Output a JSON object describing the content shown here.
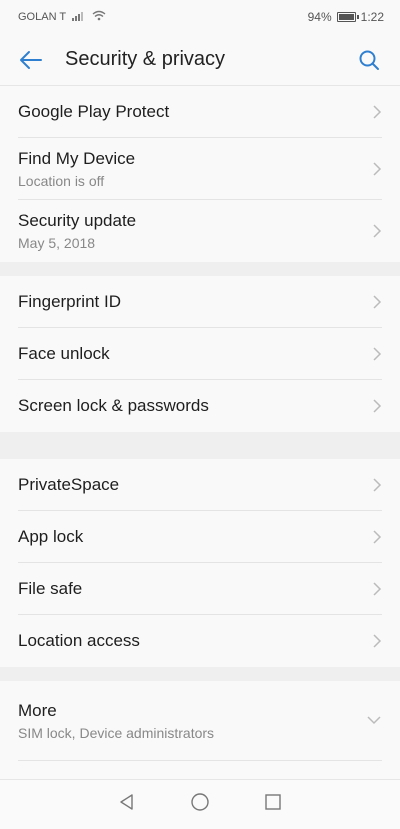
{
  "status_bar": {
    "carrier": "GOLAN T",
    "battery": "94%",
    "time": "1:22"
  },
  "app_bar": {
    "title": "Security & privacy",
    "back_icon": "arrow-left-icon",
    "search_icon": "search-icon"
  },
  "sections": [
    {
      "items": [
        {
          "title": "Google Play Protect",
          "subtitle": ""
        },
        {
          "title": "Find My Device",
          "subtitle": "Location is off"
        },
        {
          "title": "Security update",
          "subtitle": "May 5, 2018"
        }
      ]
    },
    {
      "items": [
        {
          "title": "Fingerprint ID",
          "subtitle": ""
        },
        {
          "title": "Face unlock",
          "subtitle": ""
        },
        {
          "title": "Screen lock & passwords",
          "subtitle": ""
        }
      ]
    },
    {
      "items": [
        {
          "title": "PrivateSpace",
          "subtitle": ""
        },
        {
          "title": "App lock",
          "subtitle": ""
        },
        {
          "title": "File safe",
          "subtitle": ""
        },
        {
          "title": "Location access",
          "subtitle": ""
        }
      ]
    }
  ],
  "more": {
    "title": "More",
    "subtitle": "SIM lock, Device administrators"
  },
  "colors": {
    "accent": "#2f7fd1",
    "divider": "#e4e4e4",
    "section_gap": "#efefef"
  }
}
